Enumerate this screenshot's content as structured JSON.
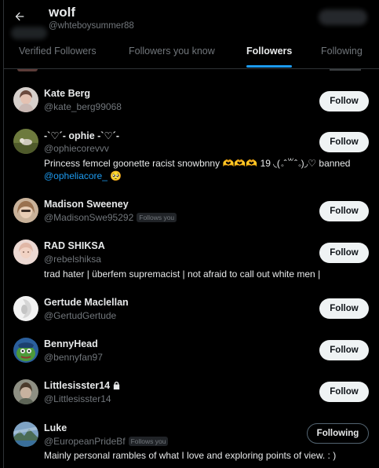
{
  "header": {
    "title": "wolf",
    "handle": "@whteboysummer88"
  },
  "tabs": [
    {
      "label": "Verified Followers"
    },
    {
      "label": "Followers you know"
    },
    {
      "label": "Followers"
    },
    {
      "label": "Following"
    }
  ],
  "active_tab": "Followers",
  "follows_you_badge": "Follows you",
  "users": [
    {
      "name": "Kate Berg",
      "handle": "@kate_berg99068",
      "button": "Follow"
    },
    {
      "name": "-`♡´- ophie -`♡´-",
      "handle": "@ophiecorevvv",
      "bio": "Princess femcel goonette racist snowbnny 🫶🫶🫶 19 ◟(｡ˆ꒳ˆ｡)◞♡ banned",
      "bio_link": "@opheliacore_",
      "bio_emoji": "🥺",
      "button": "Follow"
    },
    {
      "name": "Madison Sweeney",
      "handle": "@MadisonSwe95292",
      "button": "Follow"
    },
    {
      "name": "RAD SHIKSA",
      "handle": "@rebelshiksa",
      "bio": "trad hater | überfem supremacist | not afraid to call out white men |",
      "button": "Follow"
    },
    {
      "name": "Gertude Maclellan",
      "handle": "@GertudGertude",
      "button": "Follow"
    },
    {
      "name": "BennyHead",
      "handle": "@bennyfan97",
      "button": "Follow"
    },
    {
      "name": "Littlesisster14",
      "handle": "@Littlesisster14",
      "button": "Follow"
    },
    {
      "name": "Luke",
      "handle": "@EuropeanPrideBf",
      "bio": "Mainly personal rambles of what I love and exploring points of view. : )",
      "button": "Following"
    }
  ]
}
